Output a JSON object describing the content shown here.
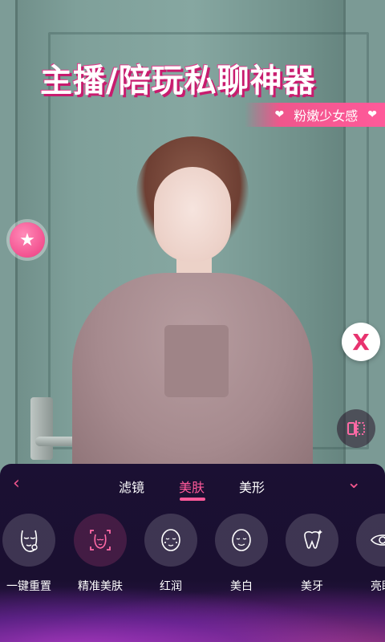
{
  "banner": {
    "title": "主播/陪玩私聊神器",
    "subtitle": "粉嫩少女感",
    "heart_left": "❤",
    "heart_right": "❤"
  },
  "side_buttons": {
    "star_icon": "star-icon",
    "beauty_logo_icon": "x-logo-icon",
    "compare_icon": "compare-icon"
  },
  "panel": {
    "tabs": [
      {
        "label": "滤镜",
        "active": false
      },
      {
        "label": "美肤",
        "active": true
      },
      {
        "label": "美形",
        "active": false
      }
    ],
    "items": [
      {
        "label": "一键重置",
        "icon": "reset-face-icon"
      },
      {
        "label": "精准美肤",
        "icon": "precise-skin-icon"
      },
      {
        "label": "红润",
        "icon": "rosy-face-icon"
      },
      {
        "label": "美白",
        "icon": "whiten-face-icon"
      },
      {
        "label": "美牙",
        "icon": "tooth-icon"
      },
      {
        "label": "亮眼",
        "icon": "eye-icon"
      }
    ]
  },
  "colors": {
    "accent": "#ff5a9a",
    "panel_bg": "#1b1033"
  }
}
